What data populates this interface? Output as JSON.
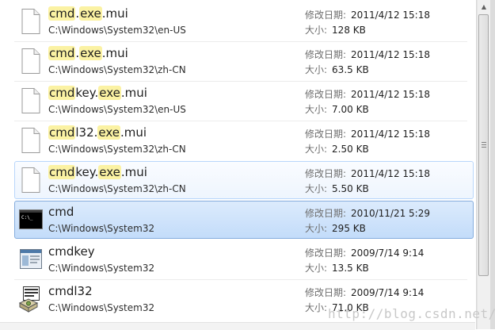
{
  "meta_labels": {
    "modified": "修改日期:",
    "size": "大小:"
  },
  "items": [
    {
      "name_parts": [
        {
          "t": "cmd",
          "hl": true
        },
        {
          "t": ".",
          "hl": false
        },
        {
          "t": "exe",
          "hl": true
        },
        {
          "t": ".mui",
          "hl": false
        }
      ],
      "path": "C:\\Windows\\System32\\en-US",
      "modified": "2011/4/12 15:18",
      "size": "128 KB",
      "icon": "blank-file-icon",
      "state": "normal"
    },
    {
      "name_parts": [
        {
          "t": "cmd",
          "hl": true
        },
        {
          "t": ".",
          "hl": false
        },
        {
          "t": "exe",
          "hl": true
        },
        {
          "t": ".mui",
          "hl": false
        }
      ],
      "path": "C:\\Windows\\System32\\zh-CN",
      "modified": "2011/4/12 15:18",
      "size": "63.5 KB",
      "icon": "blank-file-icon",
      "state": "normal"
    },
    {
      "name_parts": [
        {
          "t": "cmd",
          "hl": true
        },
        {
          "t": "key.",
          "hl": false
        },
        {
          "t": "exe",
          "hl": true
        },
        {
          "t": ".mui",
          "hl": false
        }
      ],
      "path": "C:\\Windows\\System32\\en-US",
      "modified": "2011/4/12 15:18",
      "size": "7.00 KB",
      "icon": "blank-file-icon",
      "state": "normal"
    },
    {
      "name_parts": [
        {
          "t": "cmd",
          "hl": true
        },
        {
          "t": "l32.",
          "hl": false
        },
        {
          "t": "exe",
          "hl": true
        },
        {
          "t": ".mui",
          "hl": false
        }
      ],
      "path": "C:\\Windows\\System32\\zh-CN",
      "modified": "2011/4/12 15:18",
      "size": "2.50 KB",
      "icon": "blank-file-icon",
      "state": "normal"
    },
    {
      "name_parts": [
        {
          "t": "cmd",
          "hl": true
        },
        {
          "t": "key.",
          "hl": false
        },
        {
          "t": "exe",
          "hl": true
        },
        {
          "t": ".mui",
          "hl": false
        }
      ],
      "path": "C:\\Windows\\System32\\zh-CN",
      "modified": "2011/4/12 15:18",
      "size": "5.50 KB",
      "icon": "blank-file-icon",
      "state": "hover"
    },
    {
      "name_parts": [
        {
          "t": "cmd",
          "hl": false
        }
      ],
      "path": "C:\\Windows\\System32",
      "modified": "2010/11/21 5:29",
      "size": "295 KB",
      "icon": "console-app-icon",
      "state": "selected"
    },
    {
      "name_parts": [
        {
          "t": "cmdkey",
          "hl": false
        }
      ],
      "path": "C:\\Windows\\System32",
      "modified": "2009/7/14 9:14",
      "size": "13.5 KB",
      "icon": "window-app-icon",
      "state": "normal"
    },
    {
      "name_parts": [
        {
          "t": "cmdl32",
          "hl": false
        }
      ],
      "path": "C:\\Windows\\System32",
      "modified": "2009/7/14 9:14",
      "size": "71.0 KB",
      "icon": "dialer-app-icon",
      "state": "normal"
    }
  ],
  "watermark": "http://blog.csdn.net/"
}
